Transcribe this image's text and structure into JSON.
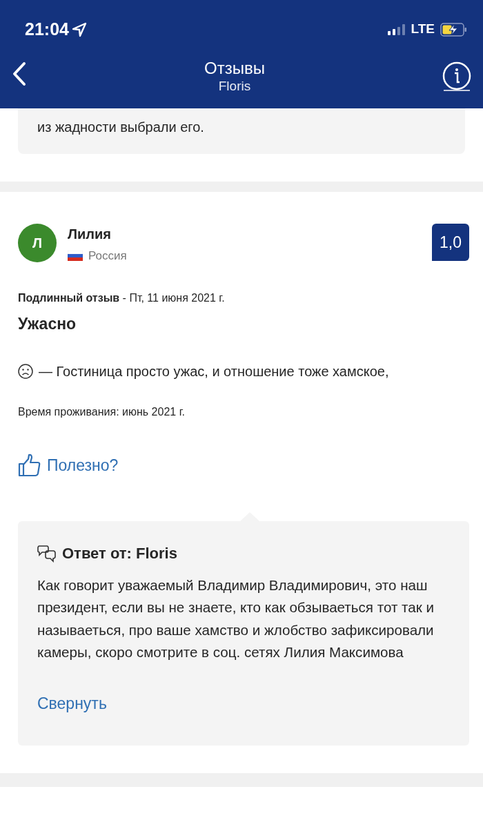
{
  "status_bar": {
    "time": "21:04",
    "network": "LTE"
  },
  "header": {
    "title": "Отзывы",
    "subtitle": "Floris"
  },
  "previous_reply": {
    "text_tail": "из жадности выбрали его."
  },
  "review": {
    "author_initial": "Л",
    "author": "Лилия",
    "country": "Россия",
    "score": "1,0",
    "meta": "**Подлинный отзыв** - Пт, 11 июня 2021 г.",
    "title": "Ужасно",
    "negative": "— Гостиница просто ужас, и отношение тоже хамское,",
    "stay": "Время проживания: июнь 2021 г.",
    "helpful": "Полезно?",
    "reply": {
      "heading": "Ответ от: Floris",
      "text": "Как говорит уважаемый Владимир Владимирович, это наш президент, если вы не знаете, кто как обзываеться тот так и называеться, про ваше хамство и жлобство зафиксировали камеры, скоро смотрите в соц. сетях Лилия Максимова",
      "collapse": "Свернуть"
    }
  }
}
